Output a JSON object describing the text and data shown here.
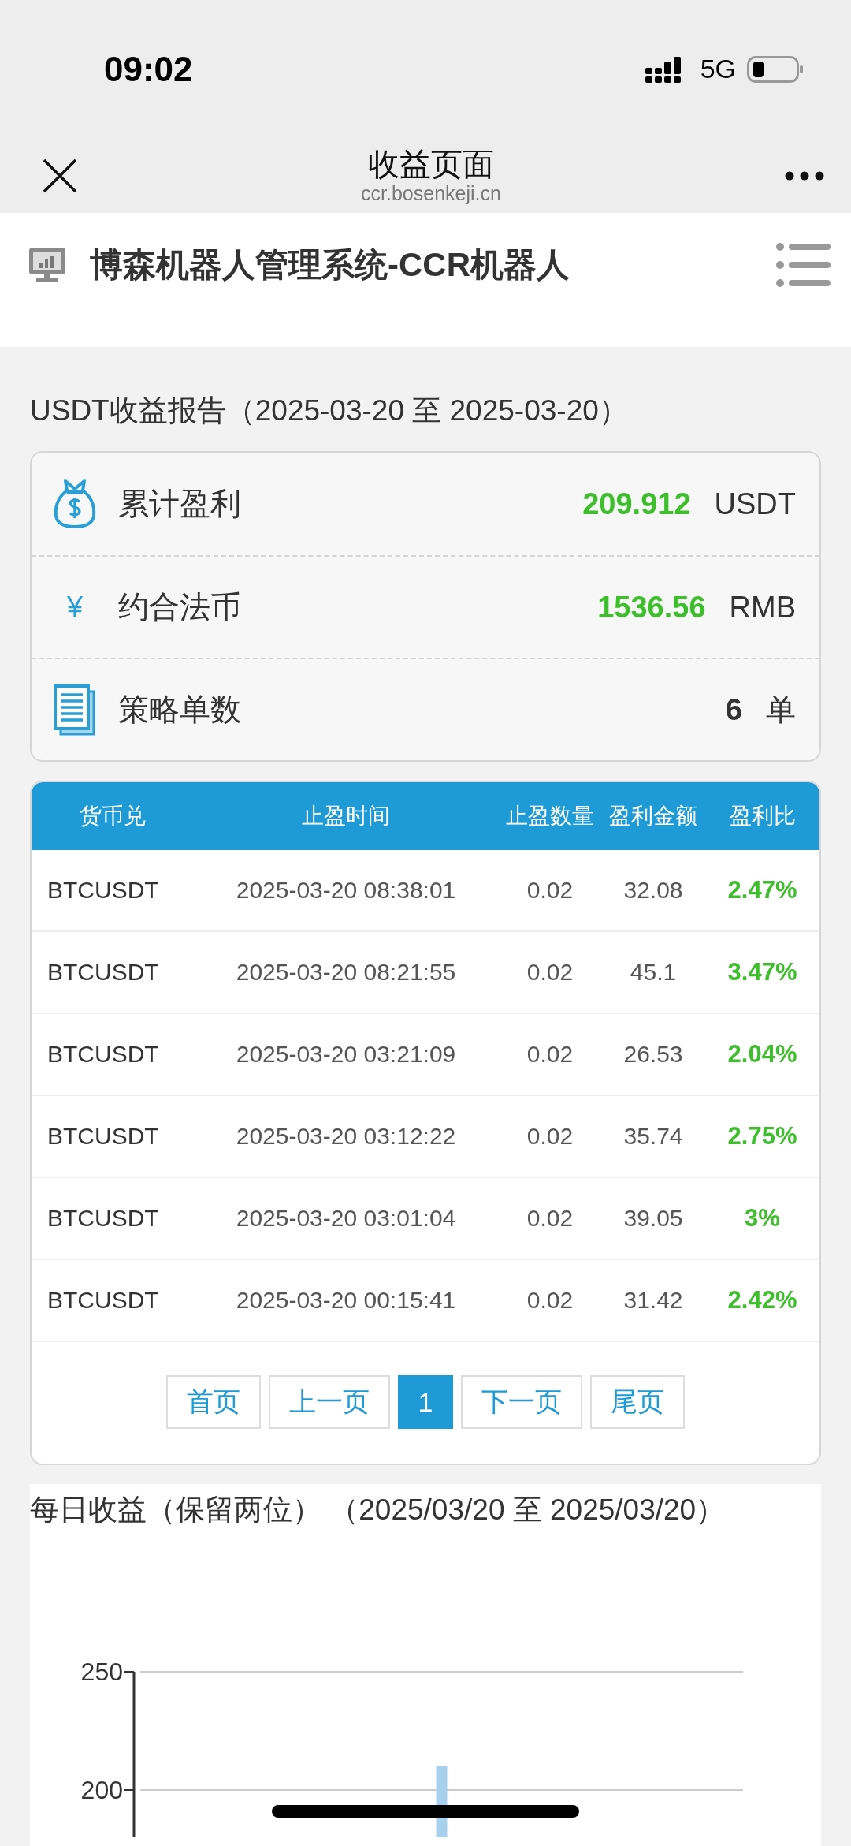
{
  "status_bar": {
    "time": "09:02",
    "network": "5G"
  },
  "nav": {
    "title": "收益页面",
    "url": "ccr.bosenkeji.cn"
  },
  "header": {
    "title": "博森机器人管理系统-CCR机器人"
  },
  "report": {
    "title": "USDT收益报告（2025-03-20 至 2025-03-20）",
    "summary": [
      {
        "kind": "bag",
        "label": "累计盈利",
        "value": "209.912",
        "unit": "USDT",
        "highlight": true
      },
      {
        "kind": "yen",
        "icon": "¥",
        "label": "约合法币",
        "value": "1536.56",
        "unit": "RMB",
        "highlight": true
      },
      {
        "kind": "doc",
        "label": "策略单数",
        "value": "6",
        "unit": "单",
        "highlight": false
      }
    ]
  },
  "table": {
    "columns": [
      "货币兑",
      "止盈时间",
      "止盈数量",
      "盈利金额",
      "盈利比"
    ],
    "rows": [
      {
        "cells": [
          "BTCUSDT",
          "2025-03-20 08:38:01",
          "0.02",
          "32.08",
          "2.47%"
        ]
      },
      {
        "cells": [
          "BTCUSDT",
          "2025-03-20 08:21:55",
          "0.02",
          "45.1",
          "3.47%"
        ]
      },
      {
        "cells": [
          "BTCUSDT",
          "2025-03-20 03:21:09",
          "0.02",
          "26.53",
          "2.04%"
        ]
      },
      {
        "cells": [
          "BTCUSDT",
          "2025-03-20 03:12:22",
          "0.02",
          "35.74",
          "2.75%"
        ]
      },
      {
        "cells": [
          "BTCUSDT",
          "2025-03-20 03:01:04",
          "0.02",
          "39.05",
          "3%"
        ]
      },
      {
        "cells": [
          "BTCUSDT",
          "2025-03-20 00:15:41",
          "0.02",
          "31.42",
          "2.42%"
        ]
      }
    ],
    "pagination": [
      {
        "label": "首页",
        "selected": false
      },
      {
        "label": "上一页",
        "selected": false
      },
      {
        "label": "1",
        "selected": true
      },
      {
        "label": "下一页",
        "selected": false
      },
      {
        "label": "尾页",
        "selected": false
      }
    ]
  },
  "daily": {
    "title": "每日收益（保留两位） （2025/03/20 至 2025/03/20）",
    "chart_data": {
      "type": "bar",
      "values": [
        210
      ],
      "ylim": [
        180,
        250
      ],
      "yticks": [
        200,
        250
      ]
    }
  }
}
